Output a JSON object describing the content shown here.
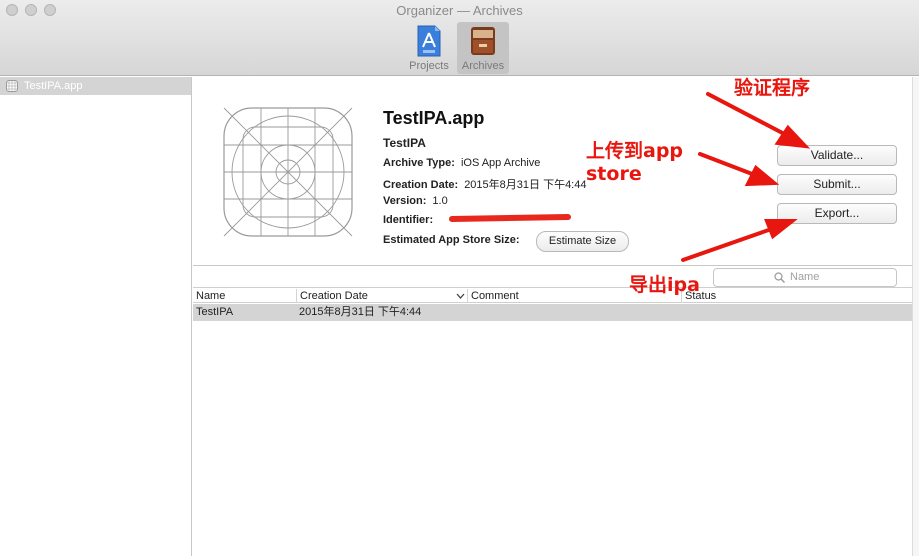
{
  "window": {
    "title": "Organizer — Archives",
    "toolbar": [
      {
        "label": "Projects",
        "icon": "app-store-icon",
        "selected": false
      },
      {
        "label": "Archives",
        "icon": "archive-box-icon",
        "selected": true
      }
    ]
  },
  "sidebar": {
    "items": [
      {
        "label": "TestIPA.app",
        "icon": "app-icon"
      }
    ]
  },
  "detail": {
    "title": "TestIPA.app",
    "name": "TestIPA",
    "fields": [
      {
        "key": "Archive Type:",
        "value": "iOS App Archive"
      },
      {
        "key": "Creation Date:",
        "value": "2015年8月31日 下午4:44"
      },
      {
        "key": "Version:",
        "value": "1.0"
      },
      {
        "key": "Identifier:",
        "value": ""
      },
      {
        "key": "Estimated App Store Size:",
        "value": ""
      }
    ],
    "estimate_button": "Estimate Size",
    "actions": {
      "validate": "Validate...",
      "submit": "Submit...",
      "export": "Export..."
    }
  },
  "search": {
    "placeholder": "Name"
  },
  "table": {
    "columns": [
      "Name",
      "Creation Date",
      "Comment",
      "Status"
    ],
    "rows": [
      {
        "name": "TestIPA",
        "date": "2015年8月31日 下午4:44",
        "comment": "",
        "status": ""
      }
    ]
  },
  "annotations": {
    "validate": "验证程序",
    "submit_line1": "上传到app",
    "submit_line2": "store",
    "export": "导出ipa",
    "color": "#e8160e"
  }
}
